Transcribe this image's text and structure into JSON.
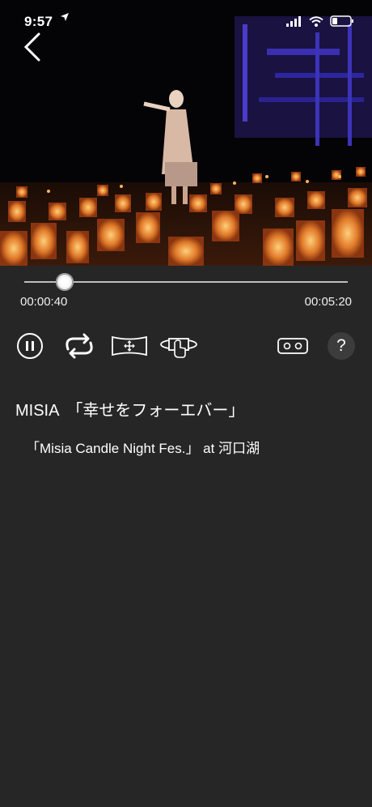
{
  "status_bar": {
    "time": "9:57",
    "location_icon": "location-arrow-icon",
    "signal_icon": "cell-signal-icon",
    "wifi_icon": "wifi-icon",
    "battery_icon": "battery-icon"
  },
  "navigation": {
    "back_icon": "chevron-left-icon"
  },
  "player": {
    "current_time": "00:00:40",
    "total_time": "00:05:20",
    "progress_fraction": 0.125
  },
  "controls": {
    "pause_icon": "pause-icon",
    "repeat_icon": "repeat-icon",
    "fit_icon": "fit-screen-icon",
    "view_360_icon": "360-view-icon",
    "vr_icon": "vr-goggles-icon",
    "help_label": "?"
  },
  "content": {
    "title": "MISIA　「幸せをフォーエバー」",
    "subtitle": "「Misia Candle Night Fes.」 at 河口湖"
  },
  "colors": {
    "background": "#262626",
    "video_bg": "#050506",
    "text": "#ffffff",
    "track": "#bdbdbd"
  }
}
